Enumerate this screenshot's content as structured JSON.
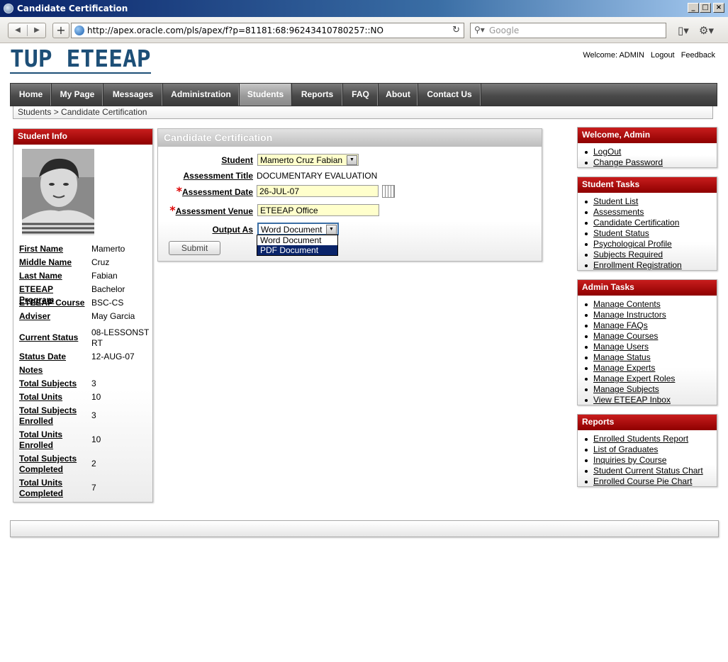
{
  "window": {
    "title": "Candidate Certification"
  },
  "browser": {
    "url": "http://apex.oracle.com/pls/apex/f?p=81181:68:96243410780257::NO",
    "search_placeholder": "Google"
  },
  "header": {
    "logo": "TUP ETEEAP",
    "welcome": "Welcome: ADMIN",
    "logout": "Logout",
    "feedback": "Feedback"
  },
  "tabs": [
    "Home",
    "My Page",
    "Messages",
    "Administration",
    "Students",
    "Reports",
    "FAQ",
    "About",
    "Contact Us"
  ],
  "active_tab": "Students",
  "breadcrumb": "Students  >  Candidate Certification",
  "student_info": {
    "title": "Student Info",
    "rows": [
      {
        "label": "First Name",
        "value": "Mamerto"
      },
      {
        "label": "Middle Name",
        "value": "Cruz"
      },
      {
        "label": "Last Name",
        "value": "Fabian"
      },
      {
        "label": "ETEEAP Program",
        "value": "Bachelor"
      },
      {
        "label": "ETEEAP Course",
        "value": "BSC-CS"
      },
      {
        "label": "Adviser",
        "value": "May Garcia"
      },
      {
        "label": "Current Status",
        "value": "08-LESSONSTRT"
      },
      {
        "label": "Status Date",
        "value": "12-AUG-07"
      },
      {
        "label": "Notes",
        "value": ""
      },
      {
        "label": "Total Subjects",
        "value": "3"
      },
      {
        "label": "Total Units",
        "value": "10"
      },
      {
        "label": "Total Subjects Enrolled",
        "value": "3"
      },
      {
        "label": "Total Units Enrolled",
        "value": "10"
      },
      {
        "label": "Total Subjects Completed",
        "value": "2"
      },
      {
        "label": "Total Units Completed",
        "value": "7"
      }
    ]
  },
  "form": {
    "title": "Candidate Certification",
    "student_label": "Student",
    "student_value": "Mamerto Cruz Fabian",
    "assessment_title_label": "Assessment Title",
    "assessment_title_value": "DOCUMENTARY EVALUATION",
    "assessment_date_label": "Assessment Date",
    "assessment_date_value": "26-JUL-07",
    "assessment_venue_label": "Assessment Venue",
    "assessment_venue_value": "ETEEAP Office",
    "output_as_label": "Output As",
    "output_as_value": "Word Document",
    "output_options": [
      "Word Document",
      "PDF Document"
    ],
    "required_mark": "*",
    "submit": "Submit"
  },
  "welcome_box": {
    "title": "Welcome, Admin",
    "links": [
      "LogOut",
      "Change Password"
    ]
  },
  "student_tasks": {
    "title": "Student Tasks",
    "links": [
      "Student List",
      "Assessments",
      "Candidate Certification",
      "Student Status",
      "Psychological Profile",
      "Subjects Required",
      "Enrollment Registration"
    ]
  },
  "admin_tasks": {
    "title": "Admin Tasks",
    "links": [
      "Manage Contents",
      "Manage Instructors",
      "Manage FAQs",
      "Manage Courses",
      "Manage Users",
      "Manage Status",
      "Manage Experts",
      "Manage Expert Roles",
      "Manage Subjects",
      "View ETEEAP Inbox"
    ]
  },
  "reports_box": {
    "title": "Reports",
    "links": [
      "Enrolled Students Report",
      "List of Graduates",
      "Inquiries by Course",
      "Student Current Status Chart",
      "Enrolled Course Pie Chart"
    ]
  }
}
